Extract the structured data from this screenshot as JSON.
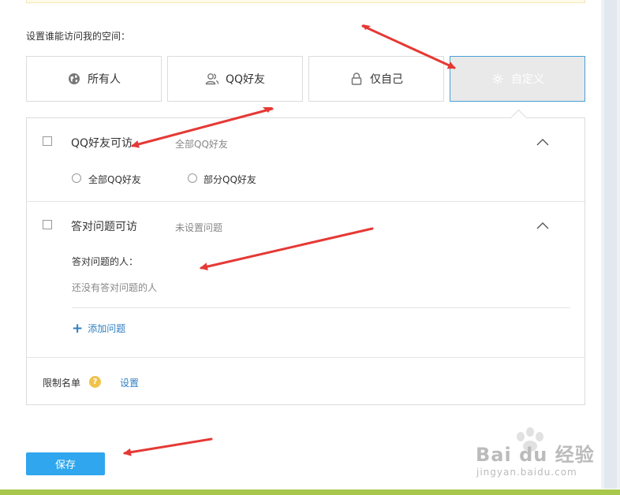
{
  "section_label": "设置谁能访问我的空间：",
  "access_options": [
    {
      "label": "所有人",
      "icon": "globe-icon"
    },
    {
      "label": "QQ好友",
      "icon": "friends-icon"
    },
    {
      "label": "仅自己",
      "icon": "lock-icon"
    },
    {
      "label": "自定义",
      "icon": "gear-icon",
      "selected": true
    }
  ],
  "qq_friends": {
    "title": "QQ好友可访",
    "desc": "全部QQ好友",
    "radios": [
      "全部QQ好友",
      "部分QQ好友"
    ]
  },
  "question": {
    "title": "答对问题可访",
    "desc": "未设置问题",
    "answered_title": "答对问题的人：",
    "empty_text": "还没有答对问题的人",
    "add_label": "添加问题"
  },
  "limit": {
    "label": "限制名单",
    "help": "?",
    "set_label": "设置"
  },
  "save_label": "保存",
  "watermark": {
    "brand": "Bai du 经验",
    "url": "jingyan.baidu.com"
  },
  "colors": {
    "accent_blue": "#2fa6ed",
    "link_blue": "#2f7fc1",
    "selected_border": "#4aa0d8",
    "arrow_red": "#e53935",
    "help_yellow": "#f0c24b"
  }
}
